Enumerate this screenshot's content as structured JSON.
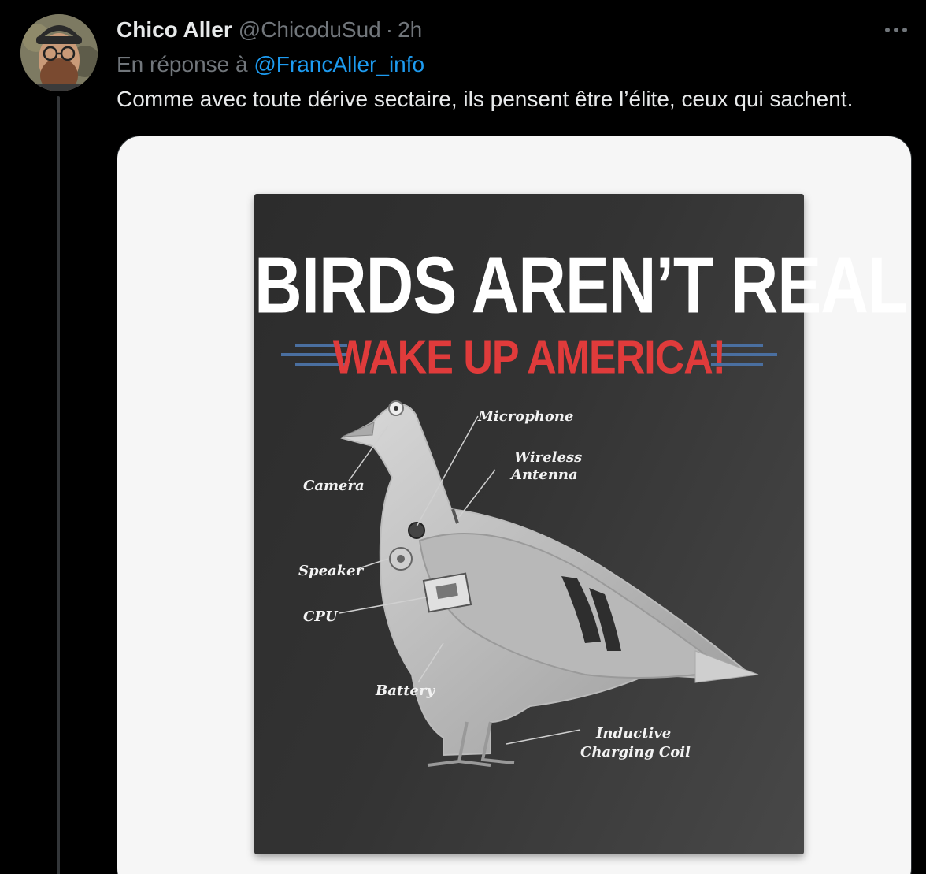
{
  "author": {
    "display_name": "Chico Aller",
    "handle": "@ChicoduSud",
    "separator": "·",
    "time": "2h"
  },
  "reply": {
    "prefix": "En réponse à",
    "mention": "@FrancAller_info"
  },
  "tweet": {
    "text": "Comme avec toute dérive sectaire, ils pensent être l’élite, ceux qui sachent."
  },
  "media": {
    "poster": {
      "title": "BIRDS AREN’T REAL",
      "subtitle": "WAKE UP AMERICA!",
      "labels": {
        "microphone": "Microphone",
        "wireless_1": "Wireless",
        "wireless_2": "Antenna",
        "camera": "Camera",
        "speaker": "Speaker",
        "cpu": "CPU",
        "battery": "Battery",
        "coil_1": "Inductive",
        "coil_2": "Charging Coil"
      }
    }
  },
  "icons": {
    "more": "more-horizontal-icon",
    "avatar": "avatar"
  },
  "colors": {
    "background": "#000000",
    "text": "#e7e9ea",
    "muted": "#71767b",
    "link": "#1d9bf0",
    "poster_title": "#ffffff",
    "poster_subtitle": "#e03b3b",
    "stripe_blue": "#4a6fa0"
  }
}
